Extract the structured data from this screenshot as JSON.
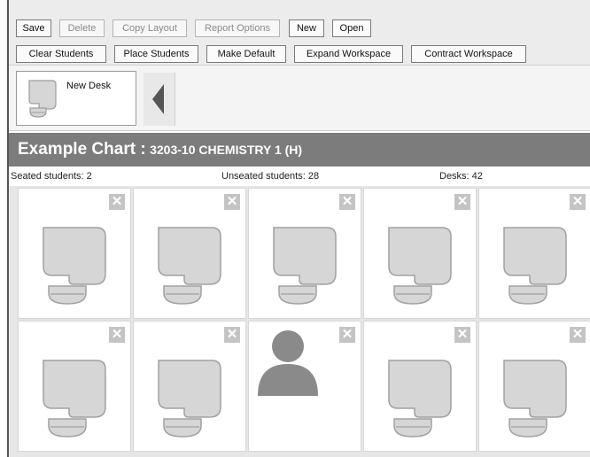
{
  "toolbar": {
    "row1": [
      {
        "name": "save-button",
        "label": "Save",
        "disabled": false
      },
      {
        "name": "delete-button",
        "label": "Delete",
        "disabled": true
      },
      {
        "name": "copy-layout-button",
        "label": "Copy Layout",
        "disabled": true
      },
      {
        "name": "report-options-button",
        "label": "Report Options",
        "disabled": true
      },
      {
        "name": "new-button",
        "label": "New",
        "disabled": false
      },
      {
        "name": "open-button",
        "label": "Open",
        "disabled": false
      }
    ],
    "row2": [
      {
        "name": "clear-students-button",
        "label": "Clear Students",
        "disabled": false
      },
      {
        "name": "place-students-button",
        "label": "Place Students",
        "disabled": false
      },
      {
        "name": "make-default-button",
        "label": "Make Default",
        "disabled": false
      },
      {
        "name": "expand-workspace-button",
        "label": "Expand Workspace",
        "disabled": false
      },
      {
        "name": "contract-workspace-button",
        "label": "Contract Workspace",
        "disabled": false
      }
    ]
  },
  "palette": {
    "new_desk_label": "New Desk"
  },
  "chart": {
    "title": "Example Chart :",
    "course": "3203-10 CHEMISTRY 1 (H)"
  },
  "stats": {
    "seated": "Seated students: 2",
    "unseated": "Unseated students: 28",
    "desks": "Desks: 42"
  },
  "icons": {
    "remove": "close-icon",
    "desk": "desk-icon",
    "student": "person-icon",
    "collapse": "collapse-left-icon"
  },
  "seats": [
    {
      "occupied": false
    },
    {
      "occupied": false
    },
    {
      "occupied": false
    },
    {
      "occupied": false
    },
    {
      "occupied": false
    },
    {
      "occupied": false
    },
    {
      "occupied": false
    },
    {
      "occupied": true
    },
    {
      "occupied": false
    },
    {
      "occupied": false
    }
  ],
  "colors": {
    "title_bar": "#7c7c7c",
    "desk": "#d6d6d6",
    "avatar": "#8a8a8a"
  }
}
